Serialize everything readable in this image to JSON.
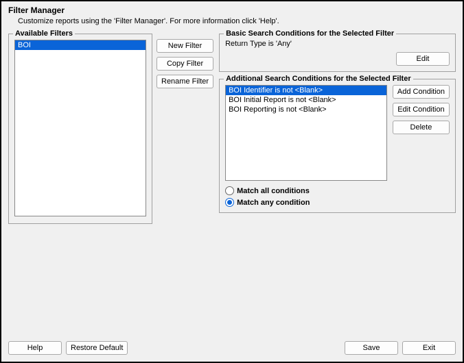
{
  "header": {
    "title": "Filter Manager",
    "subtitle": "Customize reports using the 'Filter Manager'. For more information click 'Help'."
  },
  "available": {
    "label": "Available Filters",
    "items": [
      "BOI"
    ],
    "selected_index": 0,
    "buttons": {
      "new": "New Filter",
      "copy": "Copy Filter",
      "rename": "Rename Filter"
    }
  },
  "basic": {
    "label": "Basic Search Conditions for the Selected Filter",
    "text": "Return Type is 'Any'",
    "edit": "Edit"
  },
  "additional": {
    "label": "Additional Search Conditions for the Selected Filter",
    "conditions": [
      "BOI Identifier is not <Blank>",
      "BOI Initial Report is not <Blank>",
      "BOI Reporting is not <Blank>"
    ],
    "selected_index": 0,
    "buttons": {
      "add": "Add Condition",
      "edit": "Edit Condition",
      "delete": "Delete"
    },
    "radios": {
      "match_all": "Match all conditions",
      "match_any": "Match any condition",
      "selected": "any"
    }
  },
  "footer": {
    "help": "Help",
    "restore": "Restore Default",
    "save": "Save",
    "exit": "Exit"
  }
}
